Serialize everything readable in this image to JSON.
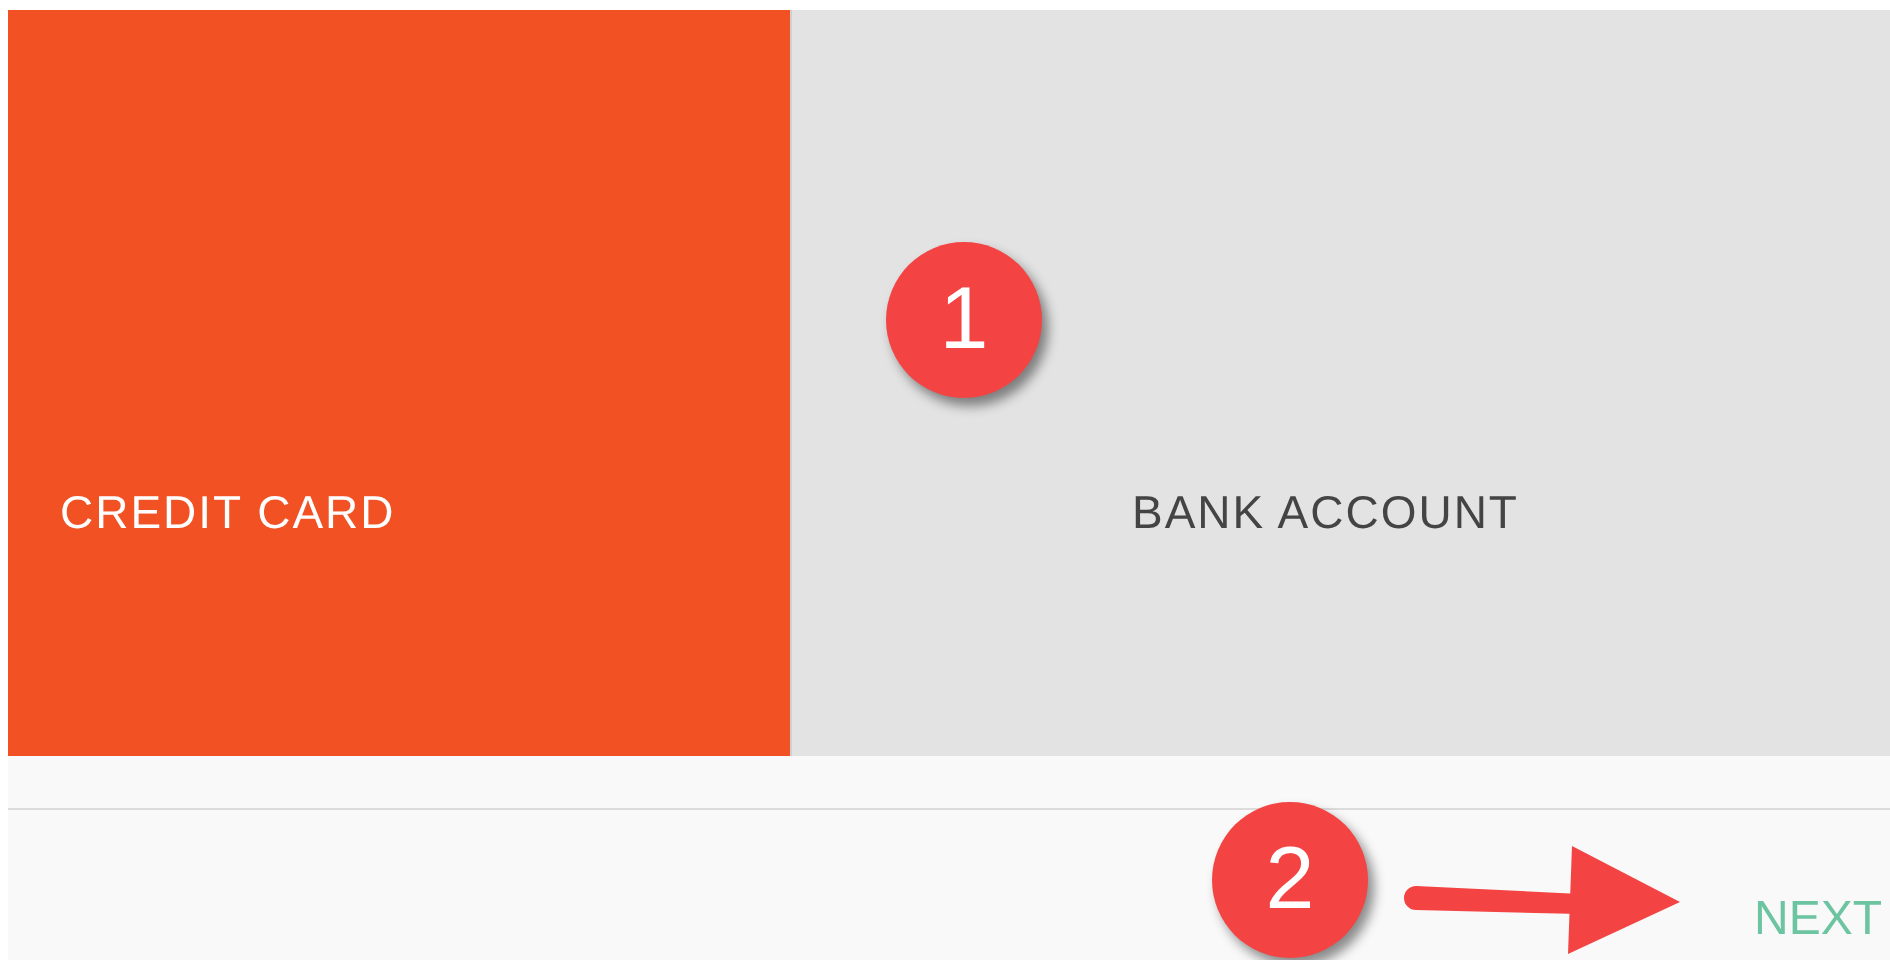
{
  "payment_options": [
    {
      "label": "CREDIT CARD",
      "selected": true
    },
    {
      "label": "BANK ACCOUNT",
      "selected": false
    }
  ],
  "annotations": [
    {
      "number": "1"
    },
    {
      "number": "2"
    }
  ],
  "next_button": {
    "label": "NEXT"
  }
}
